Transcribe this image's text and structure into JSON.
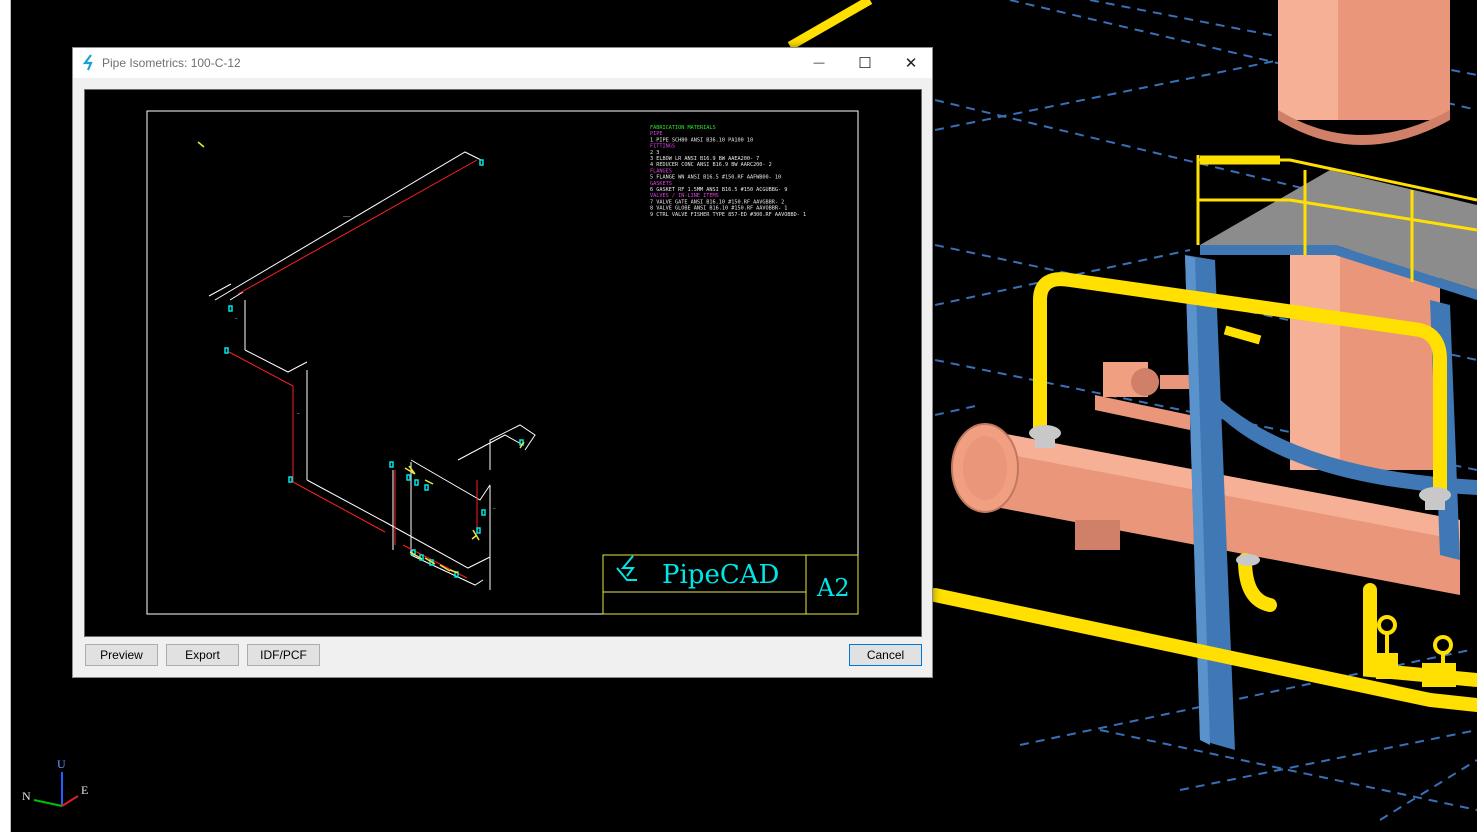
{
  "window": {
    "title": "Pipe Isometrics: 100-C-12",
    "minimize": "—",
    "maximize": "☐",
    "close": "✕"
  },
  "buttons": {
    "preview": "Preview",
    "export": "Export",
    "idf_pcf": "IDF/PCF",
    "cancel": "Cancel"
  },
  "drawing": {
    "material_list": [
      {
        "text": "FABRICATION MATERIALS",
        "color": "#2ee62e"
      },
      {
        "text": "PIPE",
        "color": "#e040e0"
      },
      {
        "text": "1 PIPE SCH80 ANSI B36.10          PA100   10",
        "color": "#e8e8e8"
      },
      {
        "text": "FITTINGS",
        "color": "#e040e0"
      },
      {
        "text": "2                                             3",
        "color": "#e8e8e8"
      },
      {
        "text": "3 ELBOW LR ANSI B16.9 BW          AAEA200-  7",
        "color": "#e8e8e8"
      },
      {
        "text": "4 REDUCER CONC ANSI B16.9 BW      AARC200-  2",
        "color": "#e8e8e8"
      },
      {
        "text": "FLANGES",
        "color": "#e040e0"
      },
      {
        "text": "5 FLANGE WN ANSI B16.5 #150.RF    AAFWB00-  10",
        "color": "#e8e8e8"
      },
      {
        "text": "GASKETS",
        "color": "#e040e0"
      },
      {
        "text": "6 GASKET RF 1.5MM ANSI B16.5 #150  ACGUBBG-  9",
        "color": "#e8e8e8"
      },
      {
        "text": "VALVES / IN-LINE ITEMS",
        "color": "#e040e0"
      },
      {
        "text": "7 VALVE GATE ANSI B16.10 #150.RF  AAVGBBR-  2",
        "color": "#e8e8e8"
      },
      {
        "text": "8 VALVE GLOBE ANSI B16.10 #150.RF AAVOBBR-  1",
        "color": "#e8e8e8"
      },
      {
        "text": "9 CTRL VALVE FISHER TYPE 857-ED #300.RF  AAVOBBD-  1",
        "color": "#e8e8e8"
      }
    ],
    "logo_text": "PipeCAD",
    "sheet_size": "A2"
  },
  "axes": {
    "up": "U",
    "north": "N",
    "east": "E"
  },
  "icons": [
    "pipecad-app-icon",
    "minimize-icon",
    "maximize-icon",
    "close-icon"
  ],
  "colors": {
    "pipe": "#ffe000",
    "vessel": "#f0a080",
    "steel": "#3f78b5",
    "grid": "#3a70b8",
    "drawing_frame": "#ffffff",
    "title_block": "#e8e840",
    "logo": "#00e5e5",
    "iso_pipe": "#ff2020"
  }
}
